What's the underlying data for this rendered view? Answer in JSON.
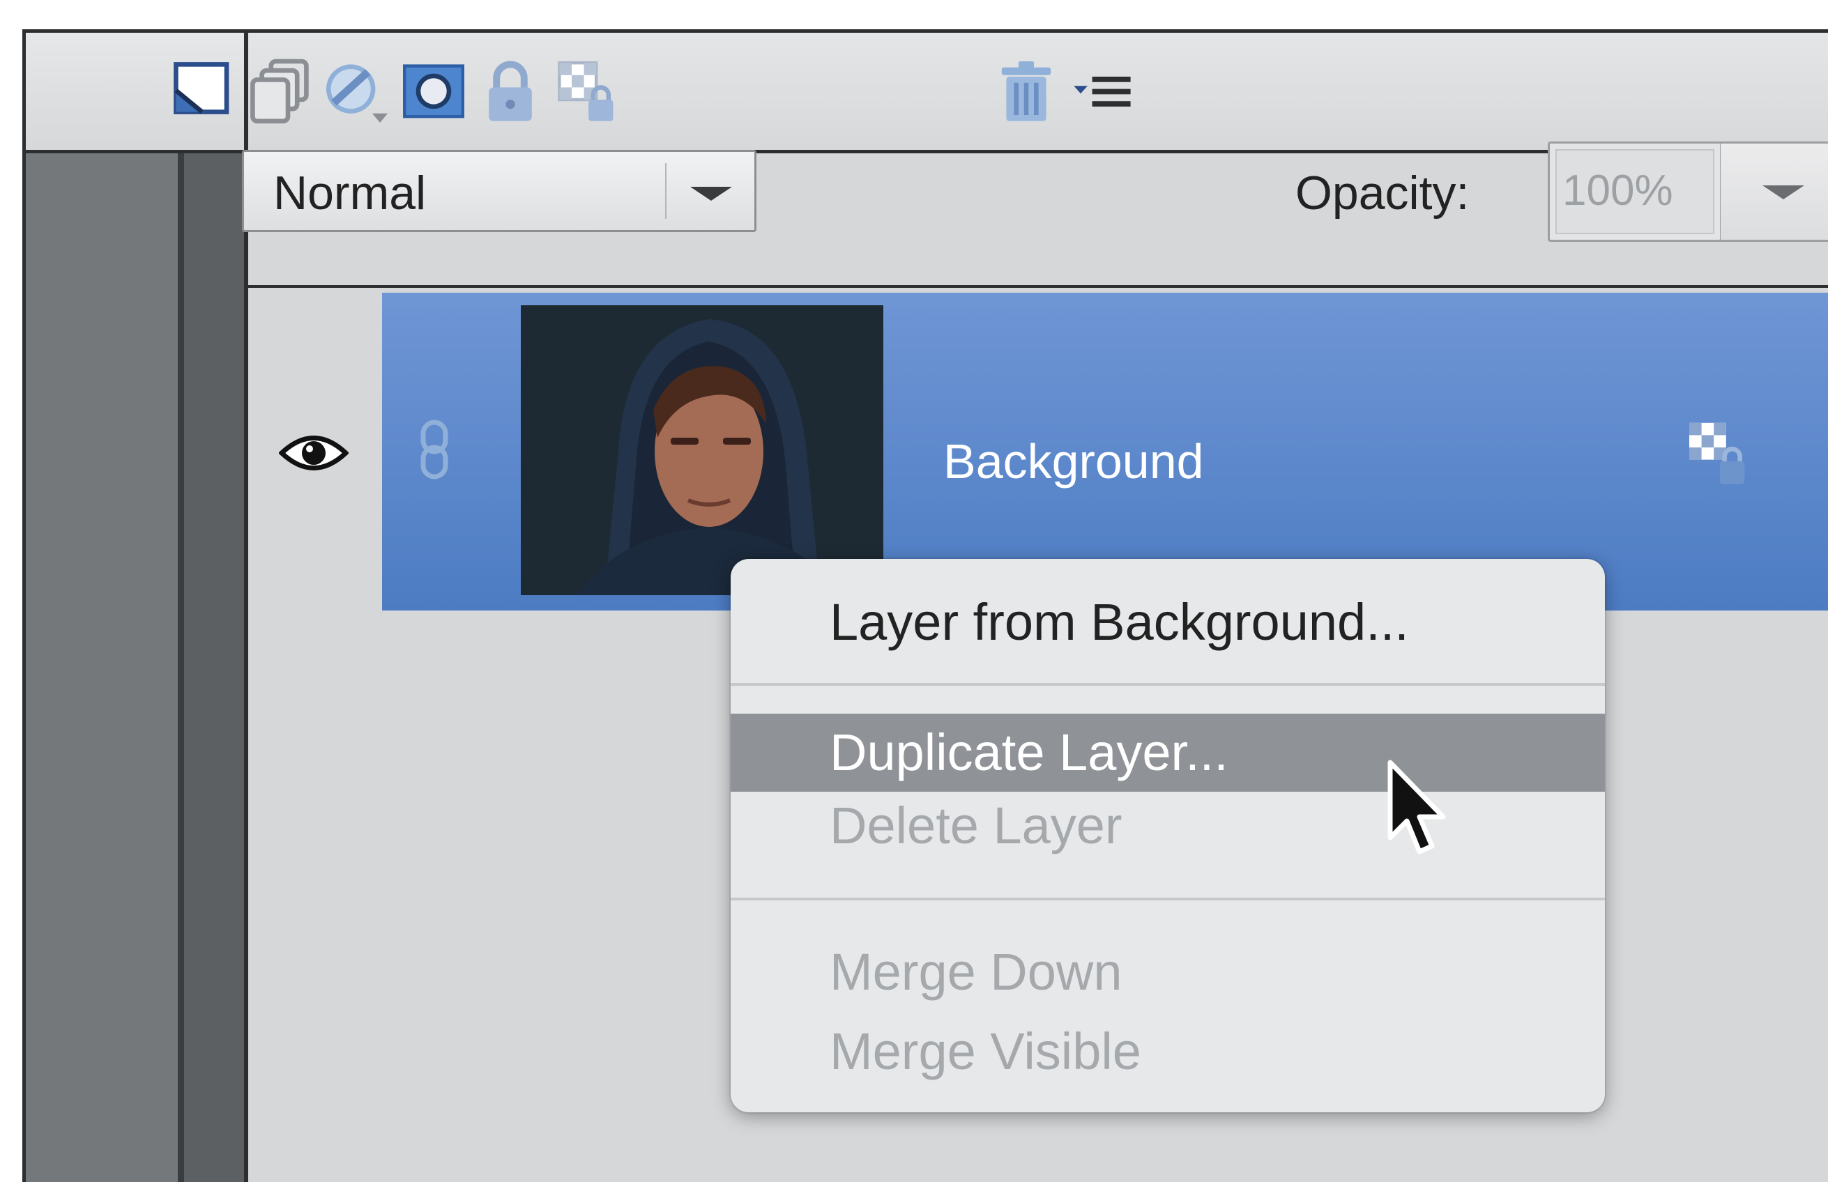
{
  "toolbar": {
    "icons": [
      "new-layer-icon",
      "new-group-icon",
      "adjustment-layer-icon",
      "layer-mask-icon",
      "lock-all-icon",
      "lock-transparency-icon",
      "trash-icon",
      "panel-menu-icon"
    ]
  },
  "blend_mode": {
    "value": "Normal"
  },
  "opacity": {
    "label": "Opacity:",
    "value": "100%"
  },
  "layer": {
    "name": "Background",
    "selected": true,
    "visible": true,
    "locked": true
  },
  "context_menu": {
    "items": [
      {
        "label": "Layer from Background...",
        "enabled": true
      },
      {
        "label": "Duplicate Layer...",
        "enabled": true,
        "highlighted": true
      },
      {
        "label": "Delete Layer",
        "enabled": false
      },
      {
        "label": "Merge Down",
        "enabled": false
      },
      {
        "label": "Merge Visible",
        "enabled": false
      }
    ]
  },
  "colors": {
    "selection_blue": "#5a86c9",
    "menu_highlight": "#8f9296",
    "panel_bg": "#d5d7d9"
  }
}
